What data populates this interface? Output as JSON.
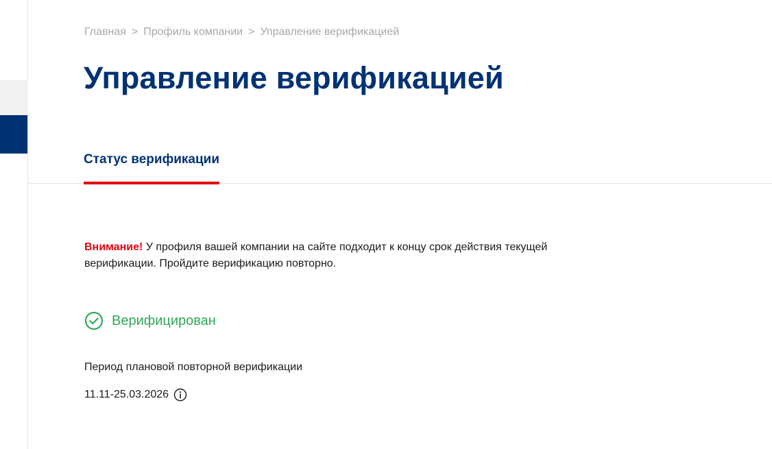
{
  "breadcrumb": {
    "items": [
      "Главная",
      "Профиль компании",
      "Управление верификацией"
    ],
    "separator": ">"
  },
  "page": {
    "title": "Управление верификацией"
  },
  "tabs": [
    {
      "label": "Статус верификации",
      "active": true
    }
  ],
  "notice": {
    "attention": "Внимание!",
    "text": " У профиля вашей компании на сайте подходит к концу срок действия текущей верификации. Пройдите верификацию повторно."
  },
  "status": {
    "label": "Верифицирован",
    "icon": "check-circle-icon"
  },
  "period": {
    "label": "Период плановой повторной верификации",
    "value": "11.11-25.03.2026",
    "icon": "info-icon"
  },
  "colors": {
    "brand_blue": "#003274",
    "accent_red": "#e30611",
    "success_green": "#2fa85a",
    "muted_gray": "#a8a8a8"
  }
}
